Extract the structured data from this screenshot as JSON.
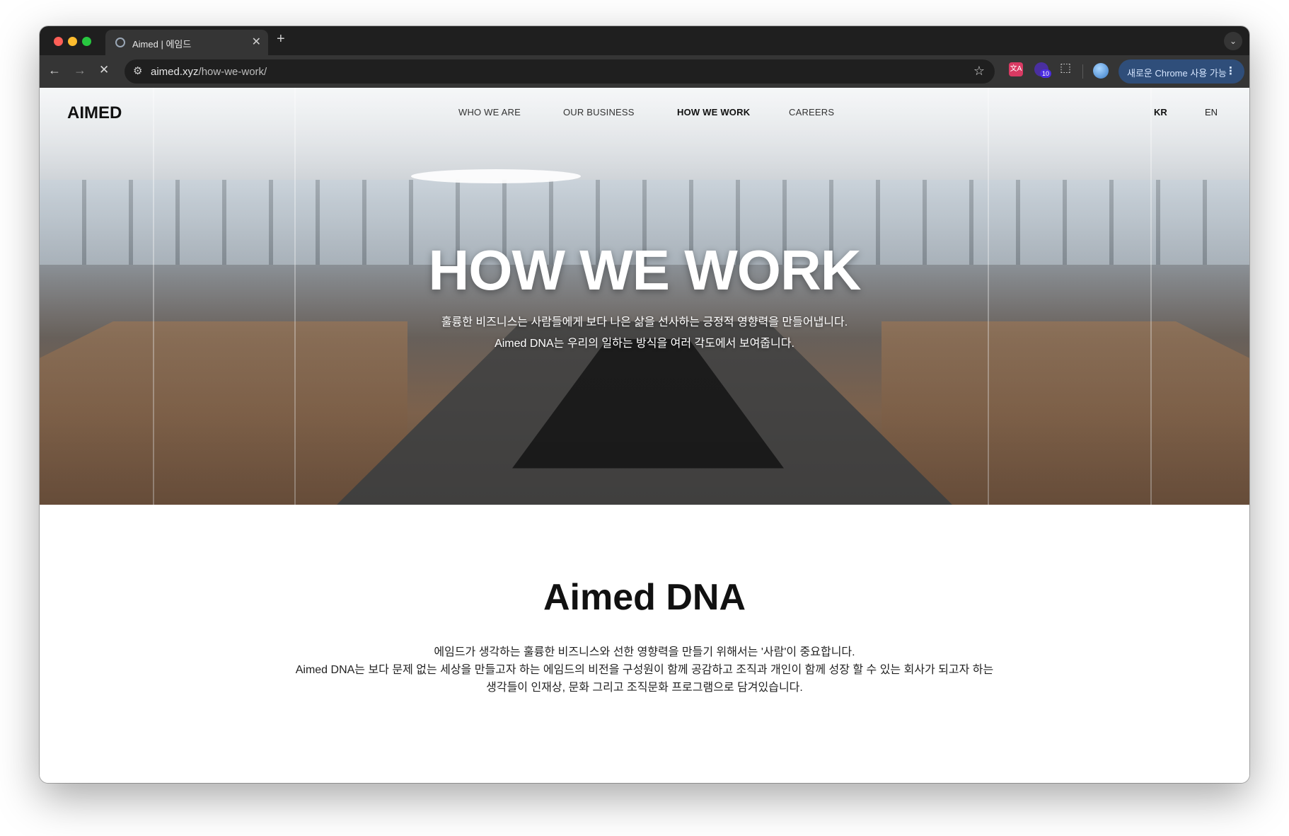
{
  "browser": {
    "tab_title": "Aimed | 에임드",
    "url_host": "aimed.xyz",
    "url_path": "/how-we-work/",
    "extension_badge": "10",
    "chrome_pill_label": "새로운 Chrome 사용 가능"
  },
  "icons": {
    "back": "←",
    "forward": "→",
    "stop": "✕",
    "site_settings": "⚙",
    "bookmark": "☆",
    "tab_close": "✕",
    "new_tab": "+",
    "tab_menu": "⌄",
    "puzzle": "⬚",
    "translate": "文A",
    "more": "⋮"
  },
  "site": {
    "logo": "AIMED",
    "nav": [
      {
        "label": "WHO WE ARE"
      },
      {
        "label": "OUR BUSINESS"
      },
      {
        "label": "HOW WE WORK"
      },
      {
        "label": "CAREERS"
      }
    ],
    "lang": [
      {
        "label": "KR"
      },
      {
        "label": "EN"
      }
    ]
  },
  "hero": {
    "title": "HOW WE WORK",
    "subtitle_line1": "훌륭한 비즈니스는 사람들에게 보다 나은 삶을 선사하는 긍정적 영향력을 만들어냅니다.",
    "subtitle_line2": "Aimed DNA는 우리의 일하는 방식을 여러 각도에서 보여줍니다."
  },
  "dna": {
    "title": "Aimed DNA",
    "line1": "에임드가 생각하는 훌륭한 비즈니스와 선한 영향력을 만들기 위해서는 '사람'이 중요합니다.",
    "line2": "Aimed DNA는 보다 문제 없는 세상을 만들고자 하는 에임드의 비전을 구성원이 함께 공감하고 조직과 개인이 함께 성장 할 수 있는 회사가 되고자 하는",
    "line3": "생각들이 인재상, 문화 그리고 조직문화 프로그램으로 담겨있습니다."
  },
  "colors": {
    "tabstrip": "#1f1f1f",
    "toolbar": "#353535",
    "pill": "#2f4e7a",
    "hero_text": "#ffffff",
    "body_text": "#111111"
  }
}
